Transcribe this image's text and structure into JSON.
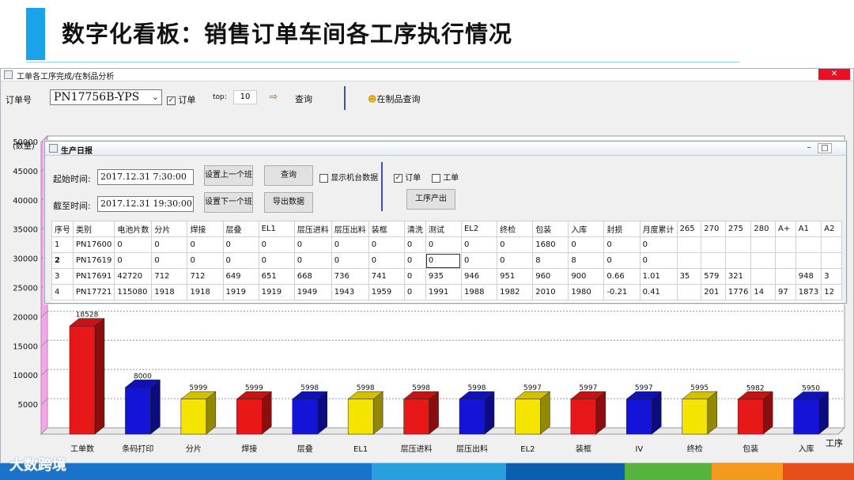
{
  "slide": {
    "title": "数字化看板：销售订单车间各工序执行情况",
    "brand": "大数跨境"
  },
  "window": {
    "title": "工单各工序完成/在制品分析",
    "close": "✕",
    "order_label": "订单号",
    "order_value": "PN17756B-YPS",
    "order_checkbox_label": "订单",
    "order_checkbox_checked": true,
    "top_label": "top:",
    "top_value": "10",
    "query_label": "查询",
    "wip_query_label": "在制品查询"
  },
  "report": {
    "title": "生产日报",
    "minimize": "–",
    "maximize": "□",
    "start_label": "起始时间:",
    "start_value": "2017.12.31 7:30:00",
    "end_label": "截至时间:",
    "end_value": "2017.12.31 19:30:00",
    "prev_shift": "设置上一个班",
    "next_shift": "设置下一个班",
    "query": "查询",
    "export": "导出数据",
    "show_machine": "显示机台数据",
    "show_machine_checked": false,
    "order_label": "订单",
    "order_checked": true,
    "workorder_label": "工单",
    "workorder_checked": false,
    "process_output": "工序产出",
    "columns": [
      "序号",
      "类别",
      "电池片数",
      "分片",
      "焊接",
      "层叠",
      "EL1",
      "层压进料",
      "层压出料",
      "装框",
      "清洗",
      "测试",
      "EL2",
      "终检",
      "包装",
      "入库",
      "封损",
      "月度累计",
      "265",
      "270",
      "275",
      "280",
      "A+",
      "A1",
      "A2"
    ],
    "rows": [
      [
        "1",
        "PN17600",
        "0",
        "0",
        "0",
        "0",
        "0",
        "0",
        "0",
        "0",
        "0",
        "0",
        "0",
        "0",
        "1680",
        "0",
        "0",
        "0",
        "",
        "",
        "",
        "",
        "",
        "",
        ""
      ],
      [
        "2",
        "PN17619",
        "0",
        "0",
        "0",
        "0",
        "0",
        "0",
        "0",
        "0",
        "0",
        "0",
        "0",
        "0",
        "8",
        "8",
        "0",
        "0",
        "",
        "",
        "",
        "",
        "",
        "",
        ""
      ],
      [
        "3",
        "PN17691",
        "42720",
        "712",
        "712",
        "649",
        "651",
        "668",
        "736",
        "741",
        "0",
        "935",
        "946",
        "951",
        "960",
        "900",
        "0.66",
        "1.01",
        "35",
        "579",
        "321",
        "",
        "",
        "948",
        "3"
      ],
      [
        "4",
        "PN17721",
        "115080",
        "1918",
        "1918",
        "1919",
        "1919",
        "1949",
        "1943",
        "1959",
        "0",
        "1991",
        "1988",
        "1982",
        "2010",
        "1980",
        "-0.21",
        "0.41",
        "",
        "201",
        "1776",
        "14",
        "97",
        "1873",
        "12"
      ]
    ]
  },
  "chart_data": {
    "type": "bar",
    "ylabel": "(数量)",
    "xlabel": "工序",
    "ylim": [
      0,
      50000
    ],
    "yticks": [
      5000,
      10000,
      15000,
      20000,
      25000,
      30000,
      35000,
      40000,
      45000,
      50000
    ],
    "ytick_labels": [
      "5000",
      "10000",
      "15000",
      "20000",
      "25000",
      "30000",
      "35000",
      "40000",
      "45000",
      "50000"
    ],
    "grid": true,
    "categories": [
      "工单数",
      "条码打印",
      "分片",
      "焊接",
      "层叠",
      "EL1",
      "层压进料",
      "层压出料",
      "EL2",
      "装框",
      "IV",
      "终检",
      "包装",
      "入库"
    ],
    "values": [
      18528,
      8000,
      5999,
      5999,
      5998,
      5998,
      5998,
      5998,
      5997,
      5997,
      5997,
      5995,
      5982,
      5950
    ],
    "bar_colors": [
      "#e81818",
      "#1414d8",
      "#f5e400",
      "#e81818",
      "#1414d8",
      "#f5e400",
      "#e81818",
      "#1414d8",
      "#f5e400",
      "#e81818",
      "#1414d8",
      "#f5e400",
      "#e81818",
      "#1414d8"
    ]
  },
  "colors": {
    "accent": "#1aa3e8",
    "separator": "#3b4fbf",
    "close_red": "#e81123"
  },
  "footer_stripes": [
    "#1a73c9",
    "#2a9fe0",
    "#0b5fb0",
    "#55b340",
    "#f39a1e",
    "#e84e1b"
  ]
}
